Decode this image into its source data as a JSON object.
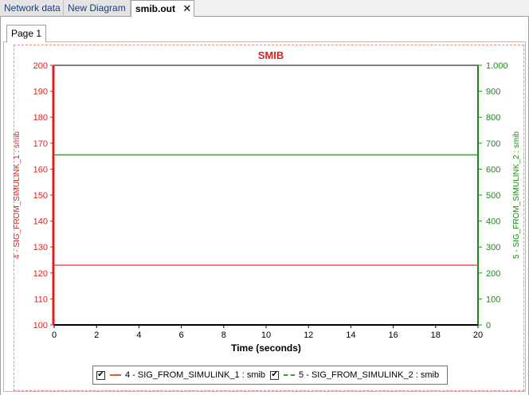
{
  "tabs": [
    {
      "label": "Network data"
    },
    {
      "label": "New Diagram"
    },
    {
      "label": "smib.out"
    }
  ],
  "page_tab": "Page 1",
  "chart_data": {
    "type": "line",
    "title": "SMIB",
    "xlabel": "Time (seconds)",
    "ylabel_left": "4 - SIG_FROM_SIMULINK_1 : smib",
    "ylabel_right": "5 - SIG_FROM_SIMULINK_2 : smib",
    "xlim": [
      0,
      20
    ],
    "ylim_left": [
      100,
      200
    ],
    "ylim_right": [
      0,
      1000
    ],
    "x_ticks": [
      0,
      2,
      4,
      6,
      8,
      10,
      12,
      14,
      16,
      18,
      20
    ],
    "y_ticks_left": [
      100,
      110,
      120,
      130,
      140,
      150,
      160,
      170,
      180,
      190,
      200
    ],
    "y_ticks_right": [
      "0",
      "100",
      "200",
      "300",
      "400",
      "500",
      "600",
      "700",
      "800",
      "900",
      "1.000"
    ],
    "series": [
      {
        "name": "4 - SIG_FROM_SIMULINK_1 : smib",
        "axis": "left",
        "color": "#e8554f",
        "style": "solid",
        "x": [
          0,
          20
        ],
        "y": [
          123,
          123
        ]
      },
      {
        "name": "5 - SIG_FROM_SIMULINK_2 : smib",
        "axis": "right",
        "color": "#3a9a3a",
        "style": "dashed",
        "x": [
          0,
          20
        ],
        "y": [
          655,
          655
        ]
      }
    ],
    "grid": false,
    "legend": "bottom"
  },
  "colors": {
    "left_axis": "#e02020",
    "right_axis": "#1a8a1a",
    "title": "#e02020"
  }
}
